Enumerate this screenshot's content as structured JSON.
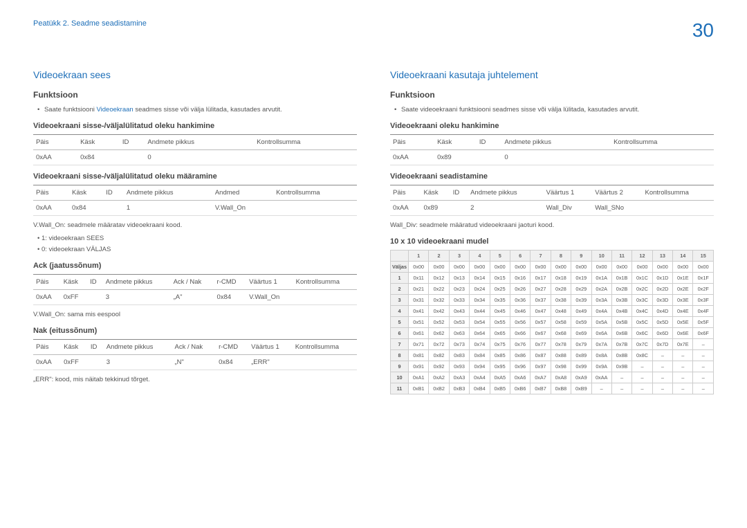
{
  "chapter": "Peatükk 2. Seadme seadistamine",
  "pagenum": "30",
  "left": {
    "title": "Videoekraan sees",
    "func_h": "Funktsioon",
    "func_txt_a": "Saate funktsiooni ",
    "func_txt_kw": "Videoekraan",
    "func_txt_b": " seadmes sisse või välja lülitada, kasutades arvutit.",
    "s1_h": "Videoekraani sisse-/väljalülitatud oleku hankimine",
    "t1": {
      "h": [
        "Päis",
        "Käsk",
        "ID",
        "Andmete pikkus",
        "Kontrollsumma"
      ],
      "r": [
        "0xAA",
        "0x84",
        "",
        "0",
        ""
      ]
    },
    "s2_h": "Videoekraani sisse-/väljalülitatud oleku määramine",
    "t2": {
      "h": [
        "Päis",
        "Käsk",
        "ID",
        "Andmete pikkus",
        "Andmed",
        "Kontrollsumma"
      ],
      "r": [
        "0xAA",
        "0x84",
        "",
        "1",
        "V.Wall_On",
        ""
      ]
    },
    "n1": "V.Wall_On: seadmele määratav videoekraani kood.",
    "n1a": "• 1: videoekraan SEES",
    "n1b": "• 0: videoekraan VÄLJAS",
    "s3_h": "Ack (jaatussõnum)",
    "t3": {
      "h": [
        "Päis",
        "Käsk",
        "ID",
        "Andmete pikkus",
        "Ack / Nak",
        "r-CMD",
        "Väärtus 1",
        "Kontrollsumma"
      ],
      "r": [
        "0xAA",
        "0xFF",
        "",
        "3",
        "„A\"",
        "0x84",
        "V.Wall_On",
        ""
      ]
    },
    "n2": "V.Wall_On: sama mis eespool",
    "s4_h": "Nak (eitussõnum)",
    "t4": {
      "h": [
        "Päis",
        "Käsk",
        "ID",
        "Andmete pikkus",
        "Ack / Nak",
        "r-CMD",
        "Väärtus 1",
        "Kontrollsumma"
      ],
      "r": [
        "0xAA",
        "0xFF",
        "",
        "3",
        "„N\"",
        "0x84",
        "„ERR\"",
        ""
      ]
    },
    "n3": "„ERR\": kood, mis näitab tekkinud tõrget."
  },
  "right": {
    "title": "Videoekraani kasutaja juhtelement",
    "func_h": "Funktsioon",
    "func_txt": "Saate videoekraani funktsiooni seadmes sisse või välja lülitada, kasutades arvutit.",
    "s1_h": "Videoekraani oleku hankimine",
    "t1": {
      "h": [
        "Päis",
        "Käsk",
        "ID",
        "Andmete pikkus",
        "Kontrollsumma"
      ],
      "r": [
        "0xAA",
        "0x89",
        "",
        "0",
        ""
      ]
    },
    "s2_h": "Videoekraani seadistamine",
    "t2": {
      "h": [
        "Päis",
        "Käsk",
        "ID",
        "Andmete pikkus",
        "Väärtus 1",
        "Väärtus 2",
        "Kontrollsumma"
      ],
      "r": [
        "0xAA",
        "0x89",
        "",
        "2",
        "Wall_Div",
        "Wall_SNo",
        ""
      ]
    },
    "n1": "Wall_Div: seadmele määratud videoekraani jaoturi kood.",
    "s3_h": "10 x 10 videoekraani mudel",
    "grid": {
      "cols": [
        "",
        "1",
        "2",
        "3",
        "4",
        "5",
        "6",
        "7",
        "8",
        "9",
        "10",
        "11",
        "12",
        "13",
        "14",
        "15"
      ],
      "rows": [
        [
          "Väljas",
          "0x00",
          "0x00",
          "0x00",
          "0x00",
          "0x00",
          "0x00",
          "0x00",
          "0x00",
          "0x00",
          "0x00",
          "0x00",
          "0x00",
          "0x00",
          "0x00",
          "0x00"
        ],
        [
          "1",
          "0x11",
          "0x12",
          "0x13",
          "0x14",
          "0x15",
          "0x16",
          "0x17",
          "0x18",
          "0x19",
          "0x1A",
          "0x1B",
          "0x1C",
          "0x1D",
          "0x1E",
          "0x1F"
        ],
        [
          "2",
          "0x21",
          "0x22",
          "0x23",
          "0x24",
          "0x25",
          "0x26",
          "0x27",
          "0x28",
          "0x29",
          "0x2A",
          "0x2B",
          "0x2C",
          "0x2D",
          "0x2E",
          "0x2F"
        ],
        [
          "3",
          "0x31",
          "0x32",
          "0x33",
          "0x34",
          "0x35",
          "0x36",
          "0x37",
          "0x38",
          "0x39",
          "0x3A",
          "0x3B",
          "0x3C",
          "0x3D",
          "0x3E",
          "0x3F"
        ],
        [
          "4",
          "0x41",
          "0x42",
          "0x43",
          "0x44",
          "0x45",
          "0x46",
          "0x47",
          "0x48",
          "0x49",
          "0x4A",
          "0x4B",
          "0x4C",
          "0x4D",
          "0x4E",
          "0x4F"
        ],
        [
          "5",
          "0x51",
          "0x52",
          "0x53",
          "0x54",
          "0x55",
          "0x56",
          "0x57",
          "0x58",
          "0x59",
          "0x5A",
          "0x5B",
          "0x5C",
          "0x5D",
          "0x5E",
          "0x5F"
        ],
        [
          "6",
          "0x61",
          "0x62",
          "0x63",
          "0x64",
          "0x65",
          "0x66",
          "0x67",
          "0x68",
          "0x69",
          "0x6A",
          "0x6B",
          "0x6C",
          "0x6D",
          "0x6E",
          "0x6F"
        ],
        [
          "7",
          "0x71",
          "0x72",
          "0x73",
          "0x74",
          "0x75",
          "0x76",
          "0x77",
          "0x78",
          "0x79",
          "0x7A",
          "0x7B",
          "0x7C",
          "0x7D",
          "0x7E",
          "–"
        ],
        [
          "8",
          "0x81",
          "0x82",
          "0x83",
          "0x84",
          "0x85",
          "0x86",
          "0x87",
          "0x88",
          "0x89",
          "0x8A",
          "0x8B",
          "0x8C",
          "–",
          "–",
          "–"
        ],
        [
          "9",
          "0x91",
          "0x92",
          "0x93",
          "0x94",
          "0x95",
          "0x96",
          "0x97",
          "0x98",
          "0x99",
          "0x9A",
          "0x9B",
          "–",
          "–",
          "–",
          "–"
        ],
        [
          "10",
          "0xA1",
          "0xA2",
          "0xA3",
          "0xA4",
          "0xA5",
          "0xA6",
          "0xA7",
          "0xA8",
          "0xA9",
          "0xAA",
          "–",
          "–",
          "–",
          "–",
          "–"
        ],
        [
          "11",
          "0xB1",
          "0xB2",
          "0xB3",
          "0xB4",
          "0xB5",
          "0xB6",
          "0xB7",
          "0xB8",
          "0xB9",
          "–",
          "–",
          "–",
          "–",
          "–",
          "–"
        ]
      ]
    }
  }
}
